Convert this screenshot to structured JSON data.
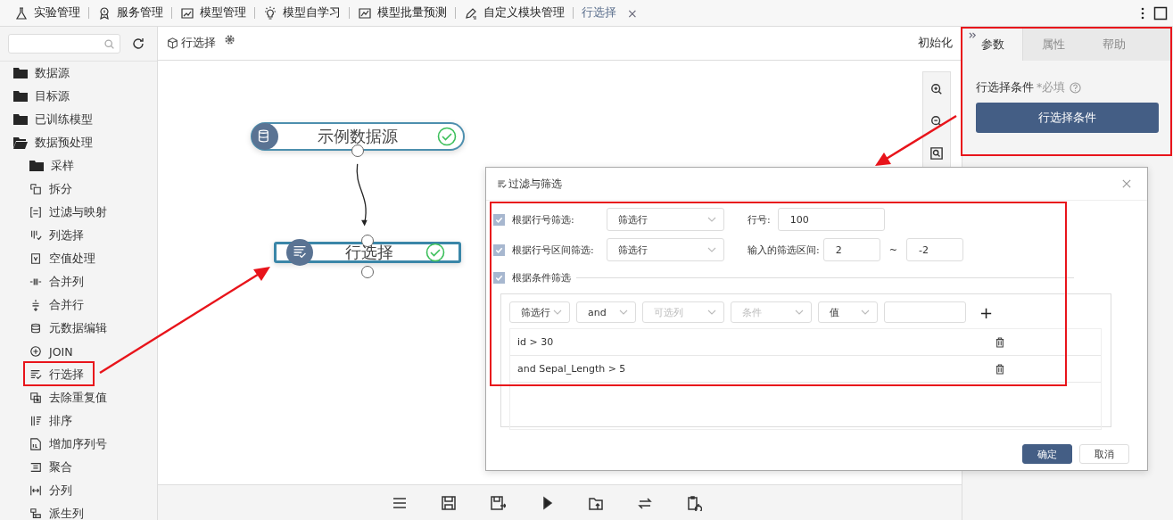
{
  "top_tabs": [
    {
      "label": "实验管理",
      "selected": false
    },
    {
      "label": "服务管理",
      "selected": false
    },
    {
      "label": "模型管理",
      "selected": false
    },
    {
      "label": "模型自学习",
      "selected": false
    },
    {
      "label": "模型批量预测",
      "selected": false
    },
    {
      "label": "自定义模块管理",
      "selected": false
    },
    {
      "label": "行选择",
      "selected": true,
      "close": "×"
    }
  ],
  "sidebar": {
    "items": [
      {
        "label": "数据源",
        "kind": "folder",
        "expanded": false
      },
      {
        "label": "目标源",
        "kind": "folder",
        "expanded": false
      },
      {
        "label": "已训练模型",
        "kind": "folder",
        "expanded": false
      },
      {
        "label": "数据预处理",
        "kind": "folder",
        "expanded": true,
        "children": [
          {
            "label": "采样",
            "kind": "folder",
            "expanded": false
          },
          {
            "label": "拆分",
            "kind": "module"
          },
          {
            "label": "过滤与映射",
            "kind": "module"
          },
          {
            "label": "列选择",
            "kind": "module"
          },
          {
            "label": "空值处理",
            "kind": "module"
          },
          {
            "label": "合并列",
            "kind": "module"
          },
          {
            "label": "合并行",
            "kind": "module"
          },
          {
            "label": "元数据编辑",
            "kind": "module"
          },
          {
            "label": "JOIN",
            "kind": "module"
          },
          {
            "label": "行选择",
            "kind": "module"
          },
          {
            "label": "去除重复值",
            "kind": "module"
          },
          {
            "label": "排序",
            "kind": "module"
          },
          {
            "label": "增加序列号",
            "kind": "module"
          },
          {
            "label": "聚合",
            "kind": "module"
          },
          {
            "label": "分列",
            "kind": "module"
          },
          {
            "label": "派生列",
            "kind": "module"
          }
        ]
      }
    ]
  },
  "canvas": {
    "title": "行选择",
    "reset": "初始化",
    "nodes": [
      {
        "label": "示例数据源",
        "done": true,
        "selected": false
      },
      {
        "label": "行选择",
        "done": true,
        "selected": true
      }
    ]
  },
  "dialog": {
    "title": "过滤与筛选",
    "row_filters": [
      {
        "checked": true,
        "label": "根据行号筛选:",
        "select": "筛选行",
        "field_label": "行号:",
        "values": [
          "100"
        ]
      },
      {
        "checked": true,
        "label": "根据行号区间筛选:",
        "select": "筛选行",
        "field_label": "输入的筛选区间:",
        "values": [
          "2",
          "-2"
        ],
        "separator": "~"
      }
    ],
    "condition_filter": {
      "checked": true,
      "label": "根据条件筛选",
      "selects": [
        {
          "value": "筛选行"
        },
        {
          "value": "and"
        },
        {
          "placeholder": "可选列"
        },
        {
          "placeholder": "条件"
        },
        {
          "value": "值"
        }
      ],
      "add": "+",
      "conditions": [
        "id > 30",
        "and Sepal_Length > 5"
      ]
    },
    "buttons": [
      {
        "label": "确定",
        "primary": true
      },
      {
        "label": "取消",
        "primary": false
      }
    ]
  },
  "panel": {
    "tabs": [
      {
        "label": "参数",
        "selected": true
      },
      {
        "label": "属性",
        "selected": false
      },
      {
        "label": "帮助",
        "selected": false
      }
    ],
    "field_label": "行选择条件",
    "required": "*必填",
    "button": "行选择条件"
  }
}
